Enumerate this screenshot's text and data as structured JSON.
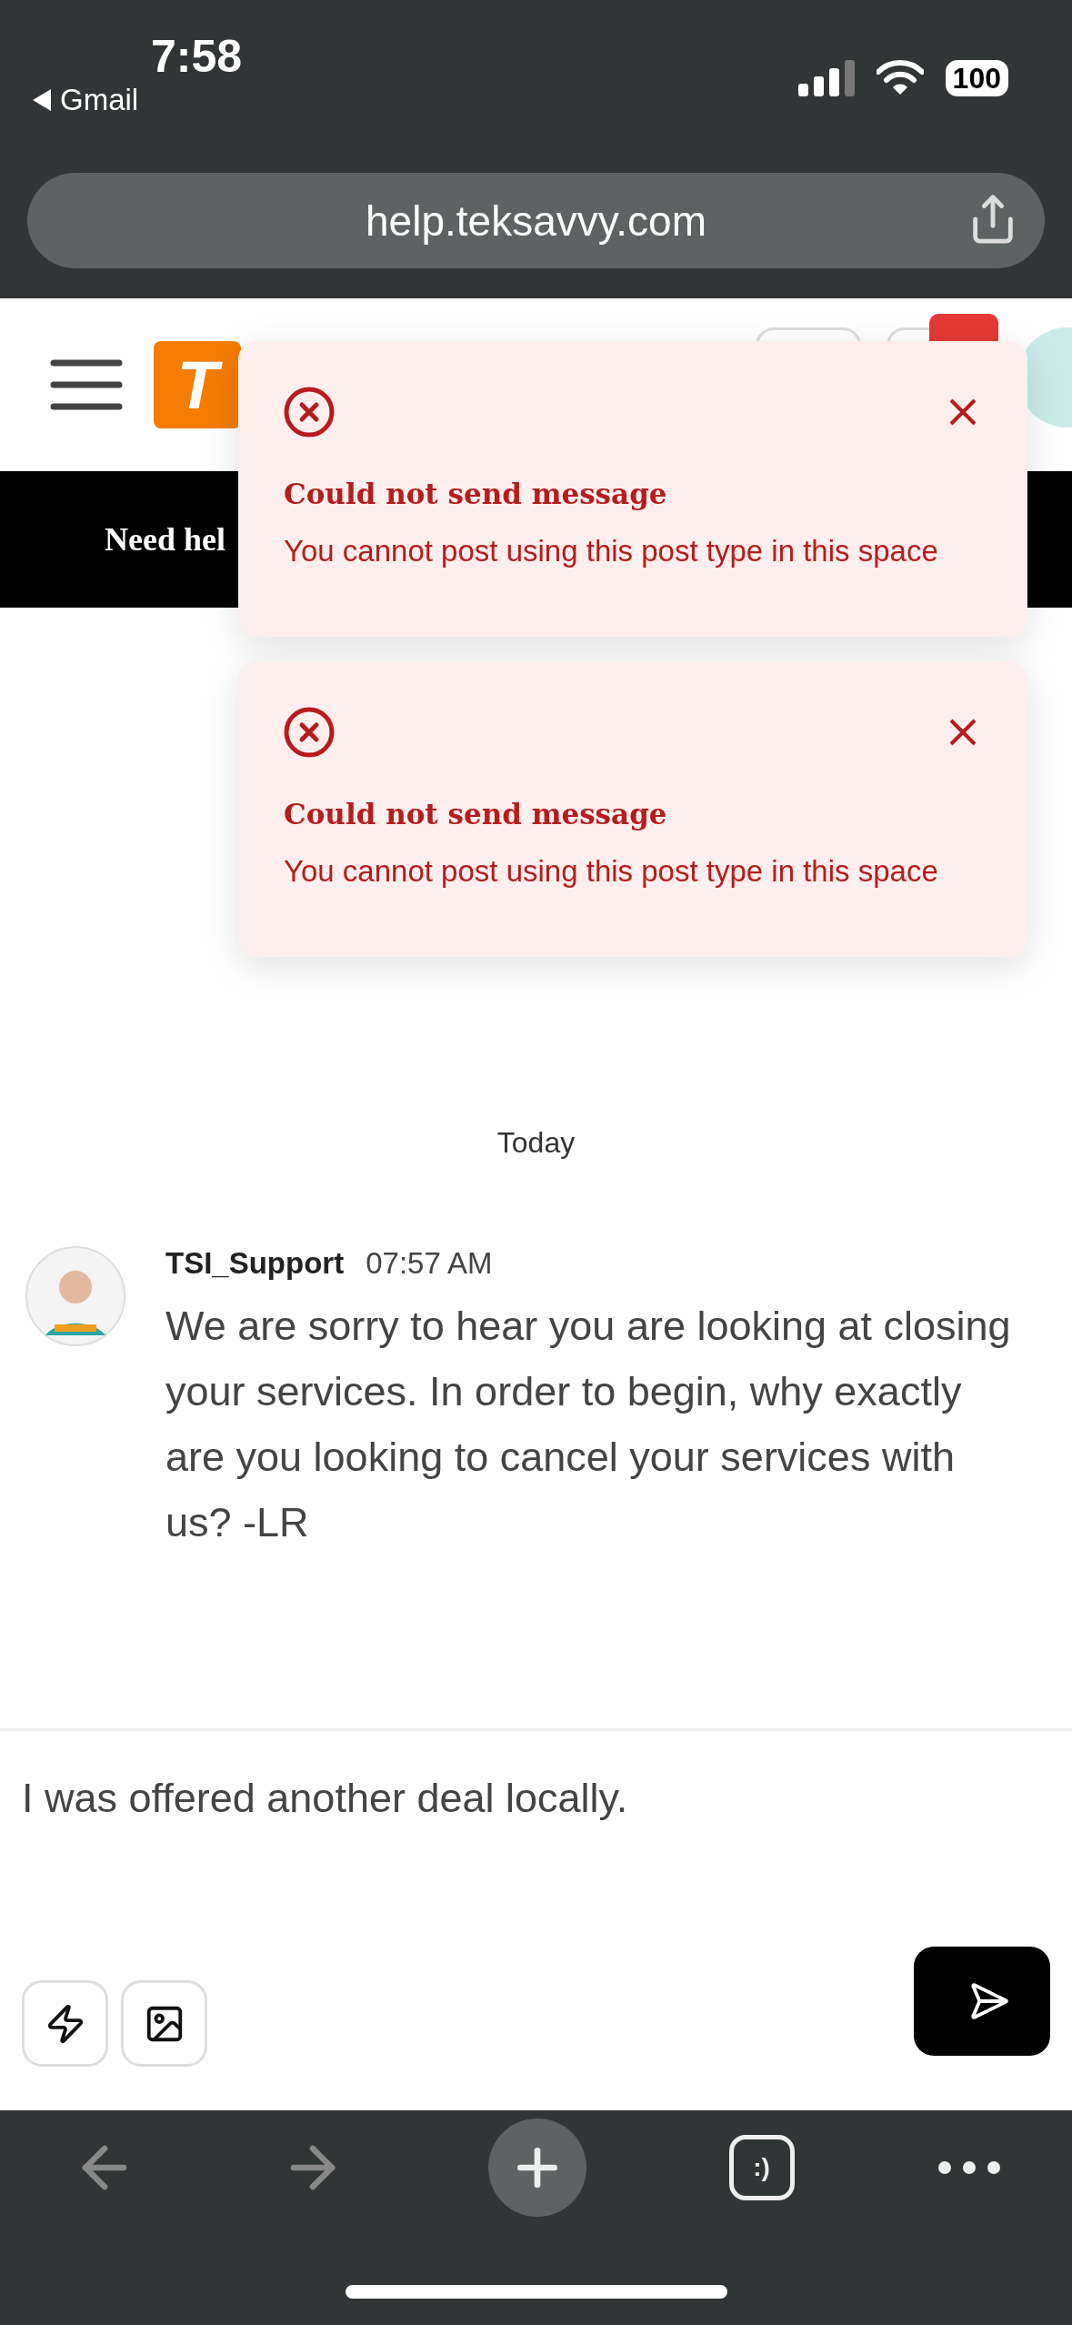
{
  "status_bar": {
    "time": "7:58",
    "back_app": "Gmail",
    "battery": "100"
  },
  "address_bar": {
    "url": "help.teksavvy.com"
  },
  "site_header": {
    "logo": "T"
  },
  "banner": {
    "text": "Need hel"
  },
  "toasts": [
    {
      "title": "Could not send message",
      "message": "You cannot post using this post type in this space"
    },
    {
      "title": "Could not send message",
      "message": "You cannot post using this post type in this space"
    }
  ],
  "date_divider": "Today",
  "messages": [
    {
      "author": "TSI_Support",
      "time": "07:57 AM",
      "text": "We are sorry to hear you are looking at closing your services. In order to begin, why exactly are you looking to cancel your services with us? -LR"
    }
  ],
  "composer": {
    "value": "I was offered another deal locally."
  },
  "browser_toolbar": {
    "tabs_label": ":)"
  }
}
